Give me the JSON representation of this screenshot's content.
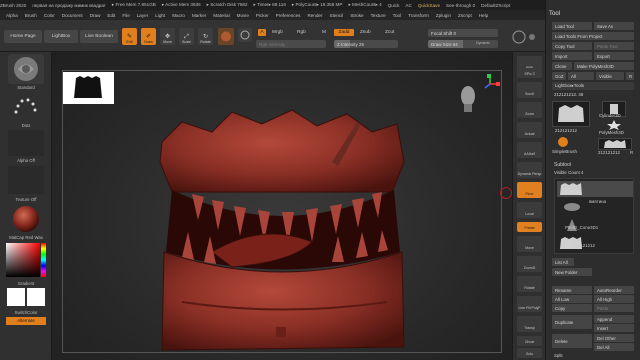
{
  "titlebar": {
    "items": [
      "ZBrush 2020",
      "первая на продажу мимик квадрат",
      "▸ Free Mem 7.851GB",
      "▸ Active Mem 3636",
      "▸ Scratch Disk 7582",
      "▸ Timer▸ 89.116",
      "▸ PolyCount▸ 19.358 MP",
      "▸ MeshCount▸ 4",
      "Quick",
      "AC",
      "QuickSave",
      "See-through 0",
      "DefaultZScript"
    ]
  },
  "menubar": {
    "items": [
      "Alpha",
      "Brush",
      "Color",
      "Document",
      "Draw",
      "Edit",
      "File",
      "Layer",
      "Light",
      "Macro",
      "Marker",
      "Material",
      "Movie",
      "Picker",
      "Preferences",
      "Render",
      "Stencil",
      "Stroke",
      "Texture",
      "Tool",
      "Transform",
      "Zplugin",
      "Zscript",
      "Help"
    ]
  },
  "shelf": {
    "home_page": "Home Page",
    "lightbox": "LightBox",
    "live_boolean": "Live Boolean",
    "edit": "Edit",
    "draw": "Draw",
    "move": "Move",
    "scale": "Scale",
    "rotate": "Rotate",
    "a_label": "A",
    "mrgb": "Mrgb",
    "rgb": "Rgb",
    "m": "M",
    "zadd": "Zadd",
    "zsub": "Zsub",
    "zcut": "Zcut",
    "rgb_intensity": "Rgb Intensity",
    "z_intensity": "Z Intensity 25",
    "focal_shift": "Focal Shift 0",
    "draw_size": "Draw Size 64",
    "dynamic": "Dynamic",
    "z_intensity_fill": 0.25,
    "draw_size_fill": 0.5
  },
  "lefttray": {
    "brush": "Standard",
    "stroke": "Dots",
    "alpha": "Alpha Off",
    "texture": "Texture Off",
    "material": "MatCap Red Wax",
    "gradient": "Gradient",
    "switch_color": "SwitchColor",
    "alternate": "Alternate"
  },
  "righticons": [
    "BPR",
    "SPix 3",
    "Scroll",
    "Zoom",
    "Actual",
    "AAHalf",
    "Dynamic Persp",
    "Floor",
    "Local",
    "Frame",
    "Move",
    "ZoomD",
    "Rotate",
    "Line Fill PolyF",
    "Transp",
    "Ghost",
    "Solo",
    "Xpose"
  ],
  "tool": {
    "title": "Tool",
    "load_tool": "Load Tool",
    "save_as": "Save As",
    "load_from_project": "Load Tools From Project",
    "copy_tool": "Copy Tool",
    "paste_tool": "Paste Tool",
    "import": "Import",
    "export": "Export",
    "clone": "Clone",
    "make_polymesh": "Make PolyMesh3D",
    "goz": "GoZ",
    "all": "All",
    "visible": "Visible",
    "r": "R",
    "lightbox_tools": "Lightbox▸Tools",
    "current_tool": "212121212. 48",
    "thumbs": [
      "212121212",
      "Cylinder3D",
      "PolyMesh3D",
      "SimpleBrush",
      "212121212"
    ],
    "r_label": "R",
    "subtool": "Subtool",
    "visible_count": "Visible Count 4",
    "subtool_items": [
      "",
      "вмятина",
      "PM3D_Cone3D1",
      "212121212"
    ],
    "list_all": "List All",
    "new_folder": "New Folder",
    "rename": "Rename",
    "autoreorder": "AutoReorder",
    "all_low": "All Low",
    "all_high": "All High",
    "copy": "Copy",
    "paste": "Paste",
    "duplicate": "Duplicate",
    "append": "Append",
    "insert": "Insert",
    "delete": "Delete",
    "del_other": "Del Other",
    "del_all": "Del All",
    "split": "Split"
  },
  "colors": {
    "accent": "#e07f1c",
    "model": "#8a2f25"
  }
}
